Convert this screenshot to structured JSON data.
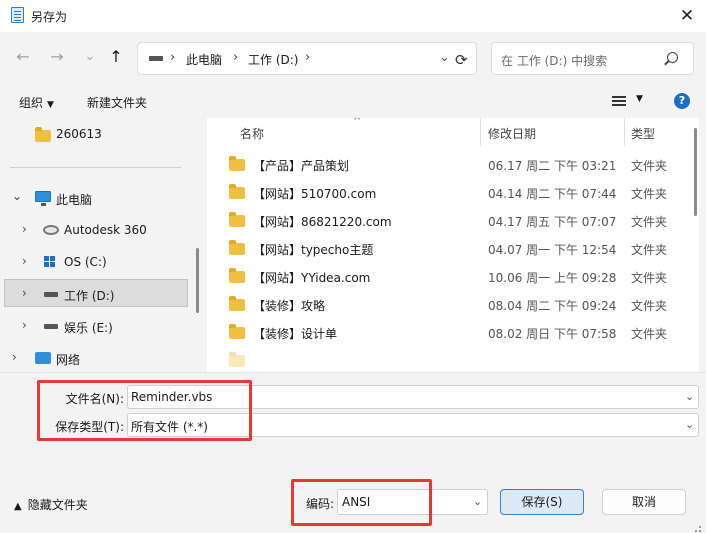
{
  "window": {
    "title": "另存为",
    "close_glyph": "✕"
  },
  "nav": {
    "back": "←",
    "forward": "→",
    "recent": "⌄",
    "up": "↑",
    "address": [
      "此电脑",
      "工作 (D:)"
    ],
    "separator": "›",
    "refresh": "⟳",
    "search_placeholder": "在 工作 (D:) 中搜索"
  },
  "toolbar": {
    "organize": "组织",
    "new_folder": "新建文件夹",
    "help": "?"
  },
  "sidebar": {
    "items": [
      {
        "label": "260613",
        "icon": "folder-icon"
      },
      {
        "label": "此电脑",
        "icon": "computer-icon",
        "expanded": true
      },
      {
        "label": "Autodesk 360",
        "icon": "cloud-drive-icon"
      },
      {
        "label": "OS (C:)",
        "icon": "windows-drive-icon"
      },
      {
        "label": "工作 (D:)",
        "icon": "drive-icon",
        "selected": true
      },
      {
        "label": "娱乐 (E:)",
        "icon": "drive-icon"
      },
      {
        "label": "网络",
        "icon": "network-icon"
      }
    ]
  },
  "filelist": {
    "columns": {
      "name": "名称",
      "date": "修改日期",
      "type": "类型"
    },
    "sort_glyph": "^",
    "rows": [
      {
        "name": "【产品】产品策划",
        "date": "06.17 周二 下午 03:21",
        "type": "文件夹"
      },
      {
        "name": "【网站】510700.com",
        "date": "04.14 周二 下午 07:44",
        "type": "文件夹"
      },
      {
        "name": "【网站】86821220.com",
        "date": "04.17 周五 下午 07:07",
        "type": "文件夹"
      },
      {
        "name": "【网站】typecho主题",
        "date": "04.07 周一 下午 12:54",
        "type": "文件夹"
      },
      {
        "name": "【网站】YYidea.com",
        "date": "10.06 周一 上午 09:28",
        "type": "文件夹"
      },
      {
        "name": "【装修】攻略",
        "date": "08.04 周二 下午 09:24",
        "type": "文件夹"
      },
      {
        "name": "【装修】设计单",
        "date": "08.02 周日 下午 07:58",
        "type": "文件夹"
      }
    ]
  },
  "form": {
    "filename_label": "文件名(N):",
    "filename_value": "Reminder.vbs",
    "filetype_label": "保存类型(T):",
    "filetype_value": "所有文件  (*.*)",
    "hide_folders": "隐藏文件夹",
    "encoding_label": "编码:",
    "encoding_value": "ANSI",
    "save": "保存(S)",
    "cancel": "取消"
  },
  "colors": {
    "highlight": "#e53935",
    "accent": "#3a7bd5",
    "folder": "#f0c040"
  }
}
